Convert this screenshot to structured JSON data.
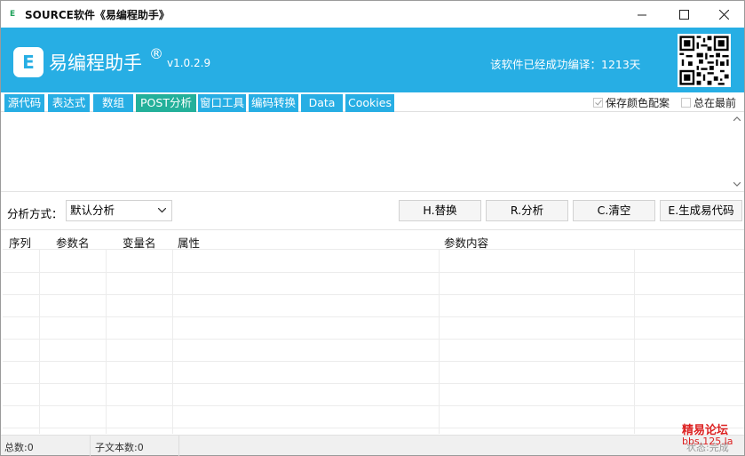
{
  "window": {
    "title": "SOURCE软件《易编程助手》",
    "app_icon_letter": "E"
  },
  "header": {
    "logo_letter": "E",
    "title": "易编程助手",
    "reg_mark": "®",
    "version": "v1.0.2.9",
    "status": "该软件已经成功编译：1213天",
    "brand_color": "#27aee4"
  },
  "tabs": [
    {
      "label": "源代码",
      "active": false
    },
    {
      "label": "表达式",
      "active": false
    },
    {
      "label": "数组",
      "active": false
    },
    {
      "label": "POST分析",
      "active": true
    },
    {
      "label": "窗口工具",
      "active": false
    },
    {
      "label": "编码转换",
      "active": false
    },
    {
      "label": "Data",
      "active": false
    },
    {
      "label": "Cookies",
      "active": false
    }
  ],
  "options": {
    "save_colors": {
      "label": "保存颜色配案",
      "checked": true
    },
    "always_on_top": {
      "label": "总在最前",
      "checked": false
    }
  },
  "analysis": {
    "label": "分析方式：",
    "mode_selected": "默认分析",
    "buttons": {
      "replace": "H.替换",
      "analyze": "R.分析",
      "clear": "C.清空",
      "generate": "E.生成易代码"
    }
  },
  "table": {
    "columns": [
      "序列",
      "参数名",
      "变量名",
      "属性",
      "参数内容"
    ]
  },
  "statusbar": {
    "total": "总数:0",
    "subtext_count": "子文本数:0",
    "state": "状态:完成"
  },
  "watermark": {
    "line1": "精易论坛",
    "line2": "bbs.125.la"
  }
}
